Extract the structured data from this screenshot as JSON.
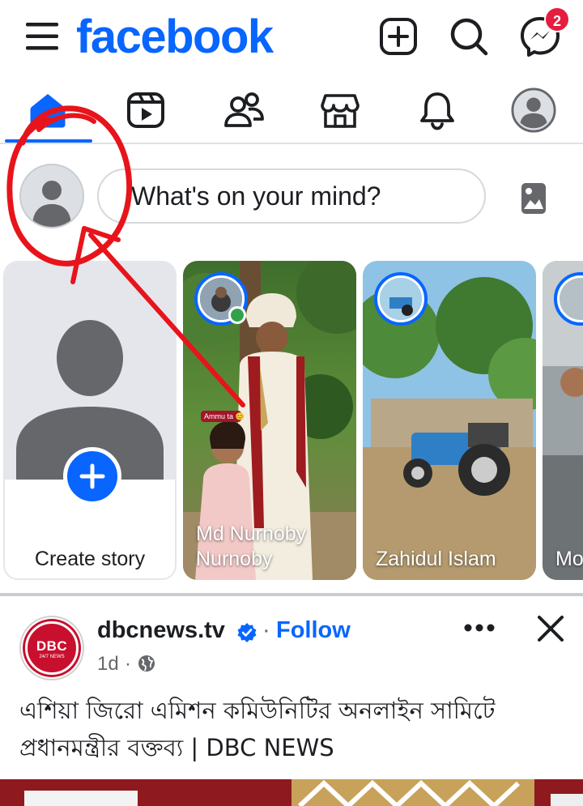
{
  "header": {
    "logo": "facebook",
    "messenger_badge": "2"
  },
  "composer": {
    "placeholder": "What's on your mind?"
  },
  "stories": {
    "create_label": "Create story",
    "items": [
      {
        "name": "Md Nurnoby Nurnoby",
        "sticker": "Ammu ta"
      },
      {
        "name": "Zahidul Islam"
      },
      {
        "name": "Mo Alo"
      }
    ]
  },
  "post": {
    "page_name": "dbcnews.tv",
    "separator": "·",
    "follow_label": "Follow",
    "time": "1d",
    "time_separator": "·",
    "avatar_text": "DBC",
    "avatar_subtext": "24/7 NEWS",
    "text": "এশিয়া জিরো এমিশন কমিউনিটির অনলাইন সামিটে প্রধানমন্ত্রীর বক্তব্য | DBC NEWS"
  },
  "colors": {
    "brand_blue": "#0866ff",
    "badge_red": "#e41e3f",
    "annotation_red": "#e8141b",
    "online_green": "#31a24c"
  },
  "icons": {
    "menu": "hamburger-icon",
    "create": "plus-square-icon",
    "search": "search-icon",
    "messenger": "messenger-icon",
    "tabs": [
      "home-icon",
      "video-icon",
      "friends-icon",
      "marketplace-icon",
      "bell-icon",
      "profile-icon"
    ],
    "photo": "photo-icon"
  }
}
